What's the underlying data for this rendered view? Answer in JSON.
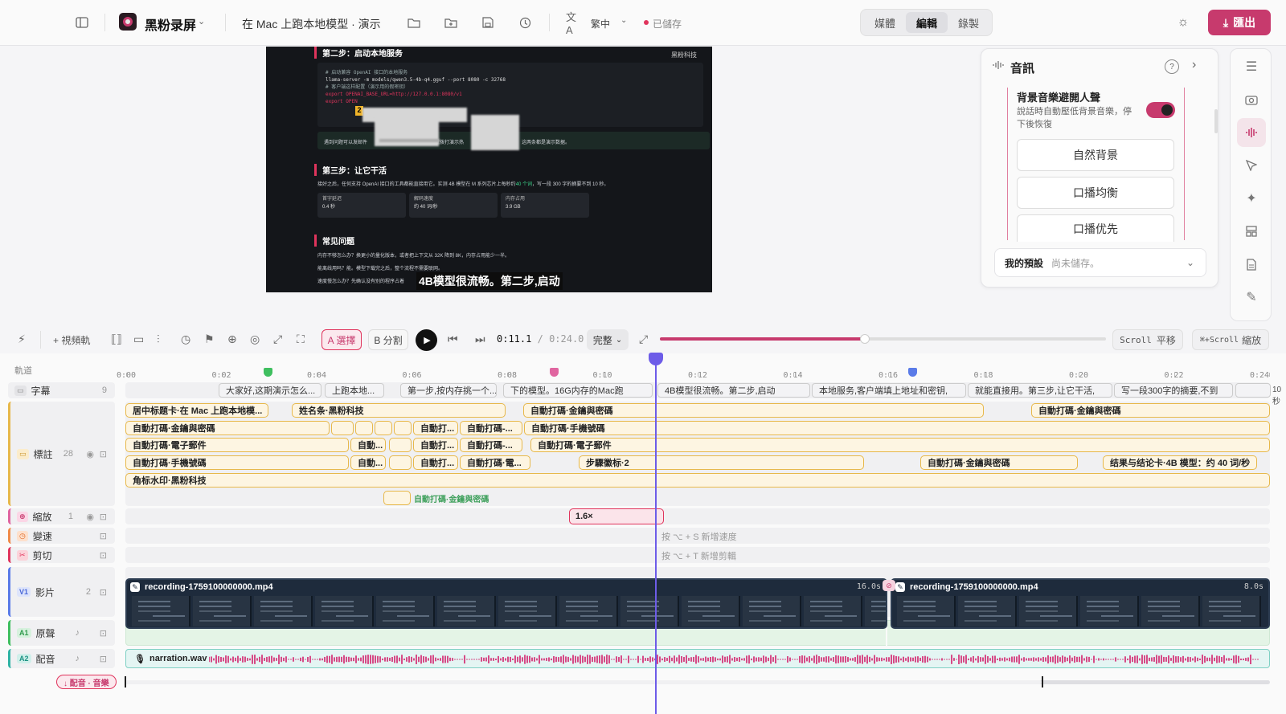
{
  "app": {
    "name": "黑粉录屏",
    "project_title": "在 Mac 上跑本地模型 · 演示",
    "language": "繁中",
    "save_status": "已儲存"
  },
  "mode_tabs": [
    {
      "label": "媒體",
      "active": false
    },
    {
      "label": "編輯",
      "active": true
    },
    {
      "label": "錄製",
      "active": false
    }
  ],
  "export_label": "匯出",
  "preview": {
    "watermark": "黑粉科技",
    "step2_title": "第二步：启动本地服务",
    "code_lines": [
      "# 启动兼容 OpenAI 接口的本地服务",
      "llama-server -m models/qwen3.5-4b-q4.gguf --port 8080 -c 32768",
      "",
      "# 客户端这样配置（演示用的假密钥）",
      "export OPENAI_BASE_URL=http://127.0.0.1:8080/v1",
      "export OPEN"
    ],
    "badge_number": "2",
    "note_text_left": "遇到问题可以发邮件",
    "note_text_mid": "或拨打演示热",
    "note_text_right": "这两条都是演示数据。",
    "step3_title": "第三步：让它干活",
    "step3_text_a": "接好之后，任何支持 OpenAI 接口的工具都能直接用它。实测 4B 模型在 M 系列芯片上每秒约",
    "step3_highlight": "40 个词",
    "step3_text_b": "，写一段 300 字的摘要不到 10 秒。",
    "metrics": [
      {
        "label": "首字延迟",
        "value": "0.4 秒"
      },
      {
        "label": "解码速度",
        "value": "约 40 词/秒"
      },
      {
        "label": "内存占用",
        "value": "3.9 GB"
      }
    ],
    "faq_title": "常见问题",
    "faq_lines": [
      "内存不够怎么办？换更小的量化版本，或者把上下文从 32K 降到 8K，内存占用能少一半。",
      "能离线用吗？能。模型下载完之后，整个流程不需要联网。",
      "速度慢怎么办？先确认没有别的程序占着"
    ],
    "subtitle": "4B模型很流畅。第二步,启动"
  },
  "audio_panel": {
    "title": "音訊",
    "setting_title": "背景音樂避開人聲",
    "setting_desc": "說話時自動壓低背景音樂，停下後恢復",
    "toggle_on": true,
    "presets": [
      "自然背景",
      "口播均衡",
      "口播优先"
    ],
    "my_presets_label": "我的預設",
    "my_presets_status": "尚未儲存。"
  },
  "toolbar": {
    "add_video_track": "+ 視頻軌",
    "select_btn": "A 選擇",
    "split_btn": "B 分割",
    "current_time": "0:11.1",
    "time_sep": "/",
    "total_time": "0:24.0",
    "quality": "完整",
    "zoom_value": 0.46,
    "scroll_hint_key": "Scroll",
    "scroll_hint_label": "平移",
    "zoom_hint_key": "⌘+Scroll",
    "zoom_hint_label": "縮放"
  },
  "timeline": {
    "tracks_header": "軌道",
    "ticks": [
      "0:00",
      "0:02",
      "0:04",
      "0:06",
      "0:08",
      "0:10",
      "0:12",
      "0:14",
      "0:16",
      "0:18",
      "0:20",
      "0:22",
      "0:24"
    ],
    "tracks": [
      {
        "name": "字幕",
        "count": "9"
      },
      {
        "name": "標註",
        "count": "28"
      },
      {
        "name": "縮放",
        "count": "1"
      },
      {
        "name": "變速",
        "count": ""
      },
      {
        "name": "剪切",
        "count": ""
      },
      {
        "name": "影片",
        "badge": "V1",
        "count": "2"
      },
      {
        "name": "原聲",
        "badge": "A1"
      },
      {
        "name": "配音",
        "badge": "A2"
      }
    ],
    "subtitles": [
      "大家好,这期演示怎么...",
      "上跑本地...",
      "第一步,按内存挑一个...",
      "下的模型。16G内存的Mac跑",
      "4B模型很流畅。第二步,启动",
      "本地服务,客户端填上地址和密钥,",
      "就能直接用。第三步,让它干活,",
      "写一段300字的摘要,不到",
      "",
      "10秒"
    ],
    "annotations": {
      "row1": [
        "居中标题卡·在 Mac 上跑本地模...",
        "姓名条·黑粉科技",
        "自動打碼·金鑰與密碼",
        "自動打碼·金鑰與密碼"
      ],
      "row2": [
        "自動打碼·金鑰與密碼",
        "自動打...",
        "自動打碼-...",
        "自動打碼·手機號碼"
      ],
      "row3": [
        "自動打碼·電子郵件",
        "自動...",
        "自動打...",
        "自動打碼-...",
        "自動打碼·電子郵件"
      ],
      "row4": [
        "自動打碼·手機號碼",
        "自動...",
        "自動打...",
        "自動打碼·電...",
        "步驟徽标·2",
        "自動打碼·金鑰與密碼",
        "结果与结论卡·4B 模型：约 40 词/秒"
      ],
      "row5": [
        "角标水印·黑粉科技"
      ],
      "row6_label": "自動打碼·金鑰與密碼"
    },
    "zoom_clip": "1.6×",
    "speed_hint": "按 ⌥ + S 新增速度",
    "cut_hint": "按 ⌥ + T 新增剪輯",
    "video_clips": [
      {
        "name": "recording-1759100000000.mp4",
        "duration": "16.0s"
      },
      {
        "name": "recording-1759100000000.mp4",
        "duration": "8.0s"
      }
    ],
    "narration_file": "narration.wav",
    "bottom_chip": "↓ 配音 · 音樂"
  },
  "colors": {
    "accent": "#c73a6d",
    "playhead": "#6d5ce8",
    "annotation_border": "#e7b84a",
    "audio_a1": "#e4f4e6",
    "audio_a2": "#e4f5f3",
    "wave": "#d64a86"
  }
}
